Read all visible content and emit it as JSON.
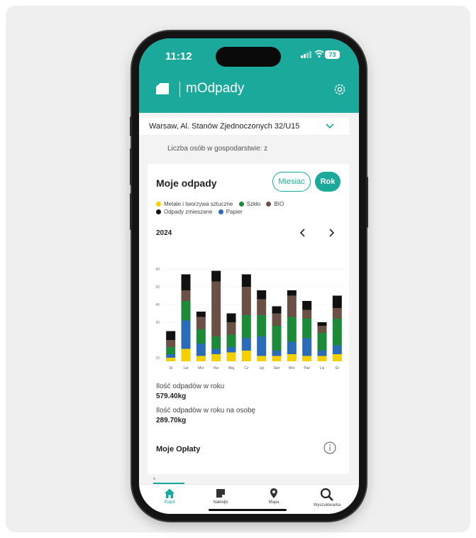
{
  "status": {
    "time": "11:12",
    "battery": "73"
  },
  "app": {
    "title": "mOdpady"
  },
  "address": {
    "selected": "Warsaw, Al. Stanów Zjednoczonych 32/U15"
  },
  "household": {
    "label": "Liczba osób w gospodarstwie: z"
  },
  "card": {
    "title": "Moje odpady",
    "btn_month": "Miesiac",
    "btn_year": "Rok",
    "year": "2024",
    "total_label": "Ilość odpadów w roku",
    "total_value": "579.40kg",
    "per_person_label": "Ilość odpadów w roku na osobę",
    "per_person_value": "289.70kg",
    "fees_title": "Moje Opłaty"
  },
  "legend": [
    {
      "name": "Metale i tworzywa sztuczne",
      "color": "#f5d000"
    },
    {
      "name": "Szkło",
      "color": "#1d8a3a"
    },
    {
      "name": "BIO",
      "color": "#6b5045"
    },
    {
      "name": "Odpady zmieszane",
      "color": "#111111"
    },
    {
      "name": "Papier",
      "color": "#2b6cb8"
    }
  ],
  "chart_data": {
    "type": "bar",
    "stacked": true,
    "categories": [
      "St",
      "Lut",
      "Mrz",
      "Kw",
      "Maj",
      "Cz",
      "Lip",
      "Sier",
      "Wrz",
      "Paź",
      "Lis",
      "Gr"
    ],
    "yticks": [
      10,
      30,
      40,
      50,
      60
    ],
    "ylim": [
      8,
      72
    ],
    "grid": true,
    "series": [
      {
        "name": "Metale i tworzywa sztuczne",
        "color": "#f5d000",
        "values": [
          2,
          7,
          3,
          4,
          5,
          6,
          3,
          3,
          4,
          3,
          3,
          4
        ]
      },
      {
        "name": "Papier",
        "color": "#2b6cb8",
        "values": [
          2,
          16,
          7,
          3,
          3,
          7,
          11,
          3,
          7,
          10,
          3,
          5
        ]
      },
      {
        "name": "Szkło",
        "color": "#1d8a3a",
        "values": [
          4,
          11,
          8,
          7,
          7,
          13,
          12,
          14,
          14,
          11,
          10,
          15
        ]
      },
      {
        "name": "BIO",
        "color": "#6b5045",
        "values": [
          4,
          6,
          7,
          31,
          7,
          16,
          9,
          7,
          12,
          5,
          4,
          6
        ]
      },
      {
        "name": "Odpady zmieszane",
        "color": "#111111",
        "values": [
          5,
          9,
          3,
          6,
          5,
          7,
          5,
          4,
          3,
          5,
          2,
          7
        ]
      }
    ]
  },
  "nav": [
    {
      "label": "Pulpit",
      "icon": "home-icon"
    },
    {
      "label": "Naklejki",
      "icon": "sticker-icon"
    },
    {
      "label": "Mapa",
      "icon": "map-pin-icon"
    },
    {
      "label": "Wyszukiwarka",
      "icon": "search-icon"
    }
  ],
  "fees_tab": {
    "label": "s"
  }
}
